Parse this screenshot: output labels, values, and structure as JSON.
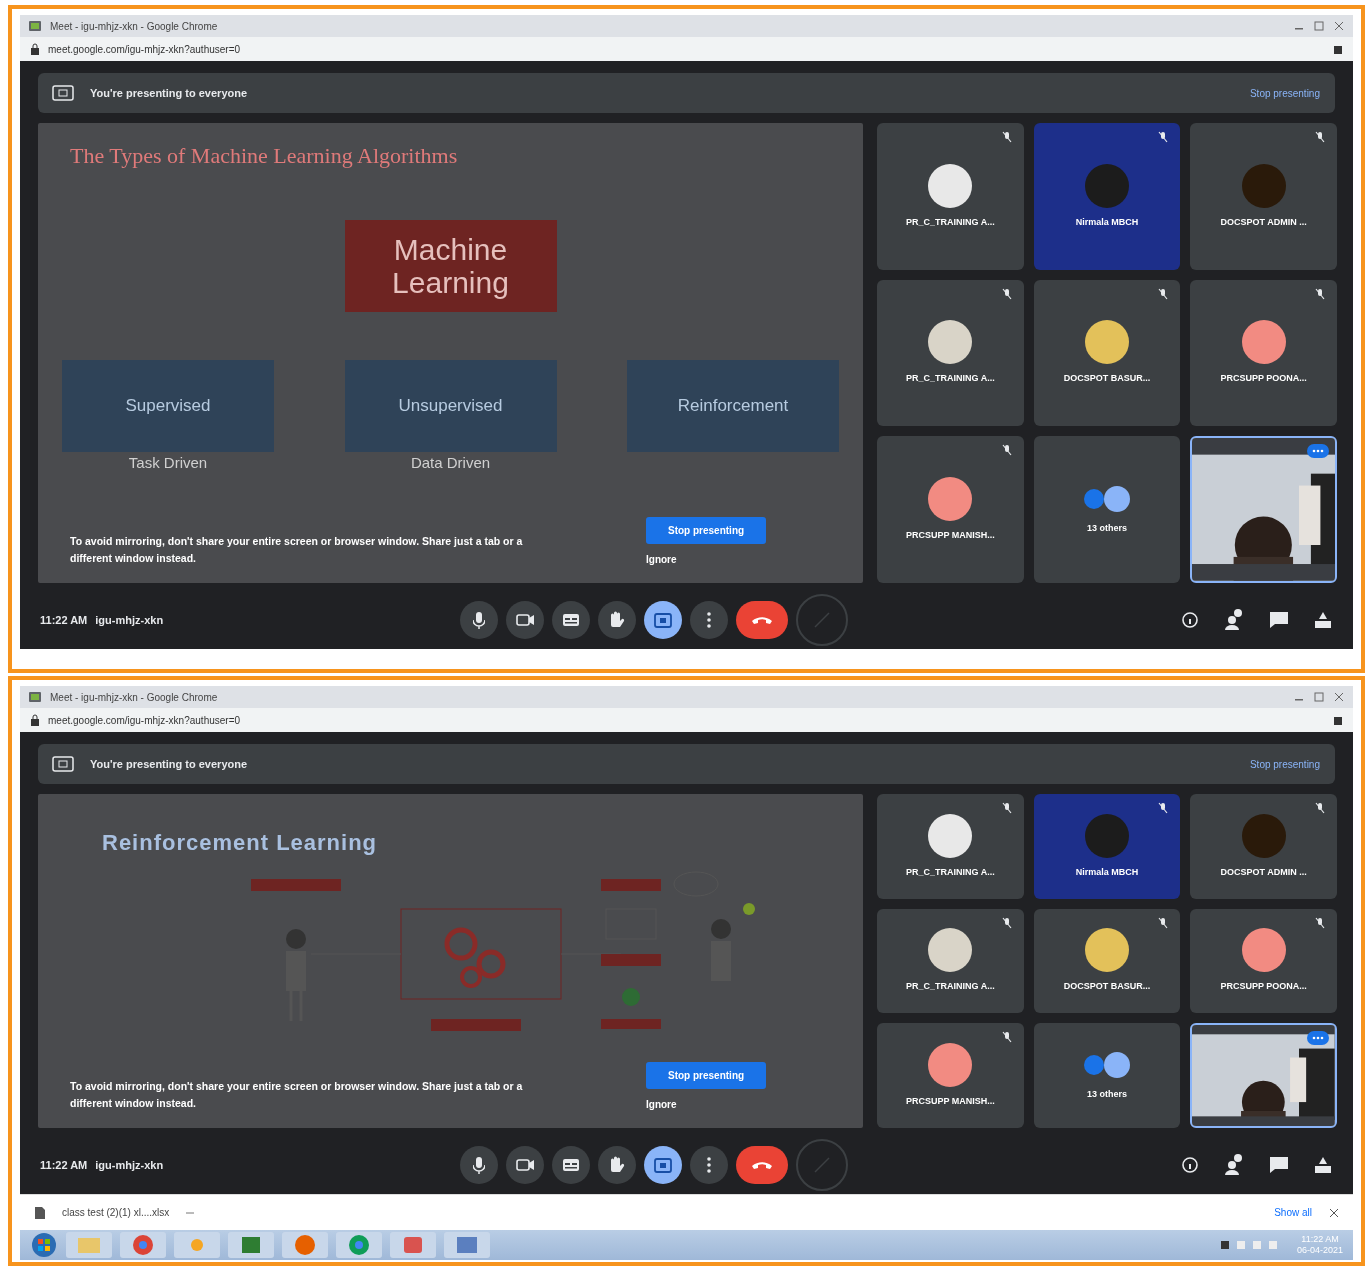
{
  "screens": [
    {
      "window_title": "Meet - igu-mhjz-xkn - Google Chrome",
      "url": "meet.google.com/igu-mhjz-xkn?authuser=0",
      "banner": {
        "text": "You're presenting to everyone",
        "action": "Stop presenting"
      },
      "slide": {
        "kind": "ml_types",
        "title": "The Types of Machine Learning Algorithms",
        "root": "Machine Learning",
        "branches": [
          {
            "label": "Supervised",
            "note": "Task Driven"
          },
          {
            "label": "Unsupervised",
            "note": "Data Driven"
          },
          {
            "label": "Reinforcement"
          }
        ]
      },
      "warning": {
        "text": "To avoid mirroring, don't share your entire screen or browser window. Share just a tab or a different window instead.",
        "button": "Stop presenting",
        "ignore": "Ignore"
      },
      "tiles": [
        {
          "kind": "participant",
          "name": "PR_C_TRAINING A...",
          "color": "#e8e8e8",
          "muted": true,
          "highlighted": false
        },
        {
          "kind": "participant",
          "name": "Nirmala MBCH",
          "color": "#1c1c1c",
          "muted": true,
          "highlighted": true
        },
        {
          "kind": "participant",
          "name": "DOCSPOT ADMIN ...",
          "color": "#2a1a0a",
          "muted": true,
          "highlighted": false
        },
        {
          "kind": "participant",
          "name": "PR_C_TRAINING A...",
          "color": "#d9d4c8",
          "muted": true,
          "highlighted": false
        },
        {
          "kind": "participant",
          "name": "DOCSPOT BASUR...",
          "color": "#e3c15a",
          "muted": true,
          "highlighted": false
        },
        {
          "kind": "participant",
          "name": "PRCSUPP POONA...",
          "color": "#f28b82",
          "muted": true,
          "highlighted": false
        },
        {
          "kind": "participant",
          "name": "PRCSUPP MANISH...",
          "color": "#f28b82",
          "muted": true,
          "highlighted": false
        },
        {
          "kind": "others",
          "name": "13 others",
          "muted": false,
          "highlighted": false
        },
        {
          "kind": "self",
          "muted": false,
          "highlighted": false
        }
      ],
      "time": "11:22 AM",
      "code": "igu-mhjz-xkn",
      "controls": [
        {
          "kind": "mic",
          "active": false
        },
        {
          "kind": "camera",
          "active": false
        },
        {
          "kind": "captions",
          "active": false
        },
        {
          "kind": "hand",
          "active": false
        },
        {
          "kind": "present",
          "active": true
        },
        {
          "kind": "more",
          "active": false
        },
        {
          "kind": "leave",
          "active": false
        },
        {
          "kind": "extra",
          "active": false
        }
      ]
    },
    {
      "window_title": "Meet - igu-mhjz-xkn - Google Chrome",
      "url": "meet.google.com/igu-mhjz-xkn?authuser=0",
      "banner": {
        "text": "You're presenting to everyone",
        "action": "Stop presenting"
      },
      "slide": {
        "kind": "rl_diagram",
        "title": "Reinforcement Learning"
      },
      "warning": {
        "text": "To avoid mirroring, don't share your entire screen or browser window. Share just a tab or a different window instead.",
        "button": "Stop presenting",
        "ignore": "Ignore"
      },
      "tiles": [
        {
          "kind": "participant",
          "name": "PR_C_TRAINING A...",
          "color": "#e8e8e8",
          "muted": true,
          "highlighted": false
        },
        {
          "kind": "participant",
          "name": "Nirmala MBCH",
          "color": "#1c1c1c",
          "muted": true,
          "highlighted": true
        },
        {
          "kind": "participant",
          "name": "DOCSPOT ADMIN ...",
          "color": "#2a1a0a",
          "muted": true,
          "highlighted": false
        },
        {
          "kind": "participant",
          "name": "PR_C_TRAINING A...",
          "color": "#d9d4c8",
          "muted": true,
          "highlighted": false
        },
        {
          "kind": "participant",
          "name": "DOCSPOT BASUR...",
          "color": "#e3c15a",
          "muted": true,
          "highlighted": false
        },
        {
          "kind": "participant",
          "name": "PRCSUPP POONA...",
          "color": "#f28b82",
          "muted": true,
          "highlighted": false
        },
        {
          "kind": "participant",
          "name": "PRCSUPP MANISH...",
          "color": "#f28b82",
          "muted": true,
          "highlighted": false
        },
        {
          "kind": "others",
          "name": "13 others",
          "muted": false,
          "highlighted": false
        },
        {
          "kind": "self",
          "muted": false,
          "highlighted": false
        }
      ],
      "time": "11:22 AM",
      "code": "igu-mhjz-xkn",
      "controls": [
        {
          "kind": "mic",
          "active": false
        },
        {
          "kind": "camera",
          "active": false
        },
        {
          "kind": "captions",
          "active": false
        },
        {
          "kind": "hand",
          "active": false
        },
        {
          "kind": "present",
          "active": true
        },
        {
          "kind": "more",
          "active": false
        },
        {
          "kind": "leave",
          "active": false
        },
        {
          "kind": "extra",
          "active": false
        }
      ]
    }
  ],
  "downloads_bar": {
    "file": "class test (2)(1) xl....xlsx",
    "show_all": "Show all"
  },
  "taskbar": {
    "time": "11:22 AM",
    "date": "06-04-2021"
  }
}
